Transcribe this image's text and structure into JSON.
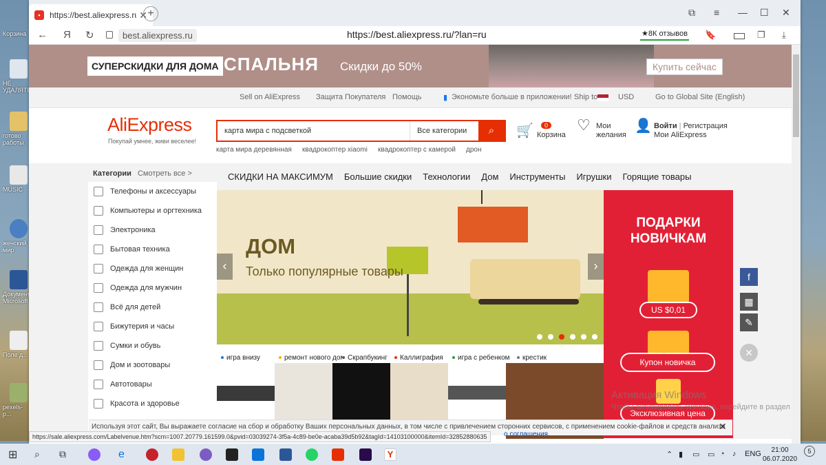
{
  "desktop": {
    "icons": [
      "Корзина",
      "НЕ УДАЛЯТЬ",
      "готово работы",
      "MUSIC",
      "женский мир",
      "Документ Microsoft",
      "Поле д...",
      "pexels-p..."
    ]
  },
  "browser": {
    "tab_title": "https://best.aliexpress.ru",
    "new_tab": "+",
    "short_url": "best.aliexpress.ru",
    "url": "https://best.aliexpress.ru/?lan=ru",
    "reviews": "★8К отзывов",
    "ya_label": "Я",
    "status_url": "https://sale.aliexpress.com/Labelvenue.htm?scm=1007.20779.161599.0&pvid=03039274-3f5a-4c89-be0e-acaba39d5b92&tagId=14103100000&itemId=32852880635"
  },
  "banner": {
    "tag": "СУПЕРСКИДКИ ДЛЯ ДОМА",
    "title": "СПАЛЬНЯ",
    "discount": "Скидки до 50%",
    "cta": "Купить сейчас"
  },
  "topnav": {
    "sell": "Sell on AliExpress",
    "protection": "Защита Покупателя",
    "help": "Помощь",
    "app": "Экономьте больше в приложении!",
    "ship": "Ship to",
    "currency": "USD",
    "global": "Go to Global Site (English)"
  },
  "header": {
    "logo": "AliExpress",
    "tagline": "Покупай умнее, живи веселее!",
    "search_value": "карта мира с подсветкой",
    "search_cat": "Все категории",
    "suggestions": [
      "карта мира деревянная",
      "квадрокоптер xiaomi",
      "квадрокоптер с камерой",
      "дрон"
    ],
    "cart_count": "0",
    "cart_label": "Корзина",
    "wish1": "Мои",
    "wish2": "желания",
    "login": "Войти",
    "register": "Регистрация",
    "my": "Мои AliExpress"
  },
  "categories": {
    "title": "Категории",
    "see_all": "Смотреть все >",
    "items": [
      "Телефоны и аксессуары",
      "Компьютеры и оргтехника",
      "Электроника",
      "Бытовая техника",
      "Одежда для женщин",
      "Одежда для мужчин",
      "Всё для детей",
      "Бижутерия и часы",
      "Сумки и обувь",
      "Дом и зоотовары",
      "Автотовары",
      "Красота и здоровье"
    ]
  },
  "menu": [
    "СКИДКИ НА МАКСИМУМ",
    "Большие скидки",
    "Технологии",
    "Дом",
    "Инструменты",
    "Игрушки",
    "Горящие товары"
  ],
  "hero": {
    "title": "ДОМ",
    "subtitle": "Только популярные товары",
    "prev": "‹",
    "next": "›"
  },
  "promo": {
    "title1": "ПОДАРКИ",
    "title2": "НОВИЧКАМ",
    "price": "US $0,01",
    "coupon": "Купон новичка",
    "exclusive": "Эксклюзивная цена"
  },
  "hot": [
    {
      "label": "игра внизу",
      "color": "#2f6fd6"
    },
    {
      "label": "ремонт нового дома",
      "color": "#f0b400"
    },
    {
      "label": "Скрапбукинг",
      "color": "#555555"
    },
    {
      "label": "Каллиграфия",
      "color": "#e62e04"
    },
    {
      "label": "игра с ребенком",
      "color": "#2a9d3a"
    },
    {
      "label": "крестик",
      "color": "#777777"
    }
  ],
  "cookie": {
    "text": "Используя этот сайт, Вы выражаете согласие на сбор и обработку Ваших персональных данных, в том числе с привлечением сторонних сервисов, с применением cookie-файлов и средств анализа",
    "policy": "о соглашения."
  },
  "watermark": {
    "line1": "Активация Windows",
    "line2": "Чтобы активировать Windows, перейдите в раздел \"Пара"
  },
  "taskbar": {
    "lang": "ENG",
    "time": "21:00",
    "date": "06.07.2020",
    "badge": "5"
  }
}
